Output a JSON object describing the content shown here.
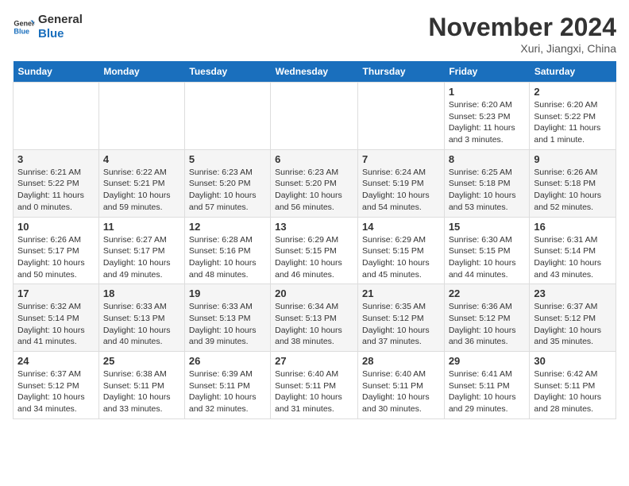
{
  "logo": {
    "line1": "General",
    "line2": "Blue"
  },
  "title": "November 2024",
  "location": "Xuri, Jiangxi, China",
  "weekdays": [
    "Sunday",
    "Monday",
    "Tuesday",
    "Wednesday",
    "Thursday",
    "Friday",
    "Saturday"
  ],
  "weeks": [
    [
      {
        "day": "",
        "info": ""
      },
      {
        "day": "",
        "info": ""
      },
      {
        "day": "",
        "info": ""
      },
      {
        "day": "",
        "info": ""
      },
      {
        "day": "",
        "info": ""
      },
      {
        "day": "1",
        "info": "Sunrise: 6:20 AM\nSunset: 5:23 PM\nDaylight: 11 hours\nand 3 minutes."
      },
      {
        "day": "2",
        "info": "Sunrise: 6:20 AM\nSunset: 5:22 PM\nDaylight: 11 hours\nand 1 minute."
      }
    ],
    [
      {
        "day": "3",
        "info": "Sunrise: 6:21 AM\nSunset: 5:22 PM\nDaylight: 11 hours\nand 0 minutes."
      },
      {
        "day": "4",
        "info": "Sunrise: 6:22 AM\nSunset: 5:21 PM\nDaylight: 10 hours\nand 59 minutes."
      },
      {
        "day": "5",
        "info": "Sunrise: 6:23 AM\nSunset: 5:20 PM\nDaylight: 10 hours\nand 57 minutes."
      },
      {
        "day": "6",
        "info": "Sunrise: 6:23 AM\nSunset: 5:20 PM\nDaylight: 10 hours\nand 56 minutes."
      },
      {
        "day": "7",
        "info": "Sunrise: 6:24 AM\nSunset: 5:19 PM\nDaylight: 10 hours\nand 54 minutes."
      },
      {
        "day": "8",
        "info": "Sunrise: 6:25 AM\nSunset: 5:18 PM\nDaylight: 10 hours\nand 53 minutes."
      },
      {
        "day": "9",
        "info": "Sunrise: 6:26 AM\nSunset: 5:18 PM\nDaylight: 10 hours\nand 52 minutes."
      }
    ],
    [
      {
        "day": "10",
        "info": "Sunrise: 6:26 AM\nSunset: 5:17 PM\nDaylight: 10 hours\nand 50 minutes."
      },
      {
        "day": "11",
        "info": "Sunrise: 6:27 AM\nSunset: 5:17 PM\nDaylight: 10 hours\nand 49 minutes."
      },
      {
        "day": "12",
        "info": "Sunrise: 6:28 AM\nSunset: 5:16 PM\nDaylight: 10 hours\nand 48 minutes."
      },
      {
        "day": "13",
        "info": "Sunrise: 6:29 AM\nSunset: 5:15 PM\nDaylight: 10 hours\nand 46 minutes."
      },
      {
        "day": "14",
        "info": "Sunrise: 6:29 AM\nSunset: 5:15 PM\nDaylight: 10 hours\nand 45 minutes."
      },
      {
        "day": "15",
        "info": "Sunrise: 6:30 AM\nSunset: 5:15 PM\nDaylight: 10 hours\nand 44 minutes."
      },
      {
        "day": "16",
        "info": "Sunrise: 6:31 AM\nSunset: 5:14 PM\nDaylight: 10 hours\nand 43 minutes."
      }
    ],
    [
      {
        "day": "17",
        "info": "Sunrise: 6:32 AM\nSunset: 5:14 PM\nDaylight: 10 hours\nand 41 minutes."
      },
      {
        "day": "18",
        "info": "Sunrise: 6:33 AM\nSunset: 5:13 PM\nDaylight: 10 hours\nand 40 minutes."
      },
      {
        "day": "19",
        "info": "Sunrise: 6:33 AM\nSunset: 5:13 PM\nDaylight: 10 hours\nand 39 minutes."
      },
      {
        "day": "20",
        "info": "Sunrise: 6:34 AM\nSunset: 5:13 PM\nDaylight: 10 hours\nand 38 minutes."
      },
      {
        "day": "21",
        "info": "Sunrise: 6:35 AM\nSunset: 5:12 PM\nDaylight: 10 hours\nand 37 minutes."
      },
      {
        "day": "22",
        "info": "Sunrise: 6:36 AM\nSunset: 5:12 PM\nDaylight: 10 hours\nand 36 minutes."
      },
      {
        "day": "23",
        "info": "Sunrise: 6:37 AM\nSunset: 5:12 PM\nDaylight: 10 hours\nand 35 minutes."
      }
    ],
    [
      {
        "day": "24",
        "info": "Sunrise: 6:37 AM\nSunset: 5:12 PM\nDaylight: 10 hours\nand 34 minutes."
      },
      {
        "day": "25",
        "info": "Sunrise: 6:38 AM\nSunset: 5:11 PM\nDaylight: 10 hours\nand 33 minutes."
      },
      {
        "day": "26",
        "info": "Sunrise: 6:39 AM\nSunset: 5:11 PM\nDaylight: 10 hours\nand 32 minutes."
      },
      {
        "day": "27",
        "info": "Sunrise: 6:40 AM\nSunset: 5:11 PM\nDaylight: 10 hours\nand 31 minutes."
      },
      {
        "day": "28",
        "info": "Sunrise: 6:40 AM\nSunset: 5:11 PM\nDaylight: 10 hours\nand 30 minutes."
      },
      {
        "day": "29",
        "info": "Sunrise: 6:41 AM\nSunset: 5:11 PM\nDaylight: 10 hours\nand 29 minutes."
      },
      {
        "day": "30",
        "info": "Sunrise: 6:42 AM\nSunset: 5:11 PM\nDaylight: 10 hours\nand 28 minutes."
      }
    ]
  ]
}
